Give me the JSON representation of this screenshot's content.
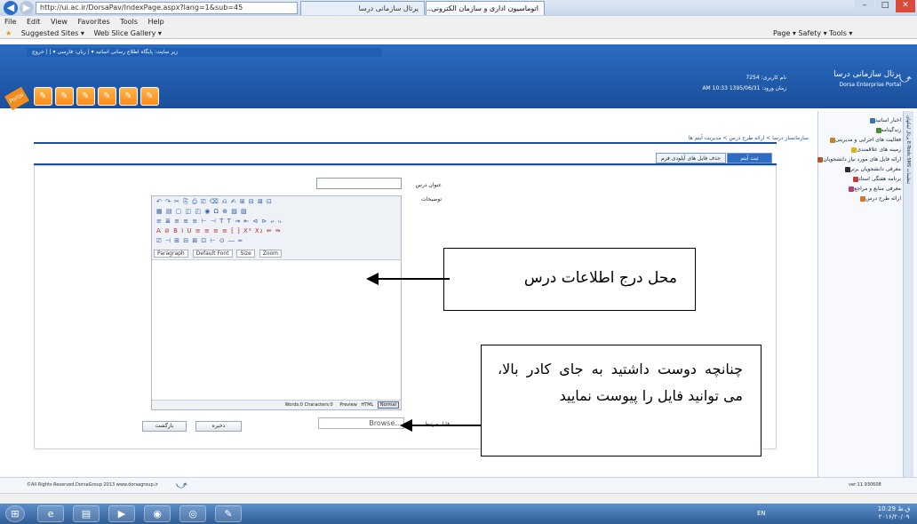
{
  "browser": {
    "address": "http://ui.ac.ir/DorsaPav/IndexPage.aspx?lang=1&sub=45",
    "search_icon": "search-icon",
    "tab1_title": "پرتال سازمانی درسا",
    "tab2_title": "اتوماسیون اداری و سازمان الکترونی...",
    "window_controls": [
      "–",
      "□",
      "✕"
    ]
  },
  "menubar": [
    "File",
    "Edit",
    "View",
    "Favorites",
    "Tools",
    "Help"
  ],
  "favorites": {
    "suggested": "Suggested Sites ▾",
    "slice": "Web Slice Gallery ▾",
    "right_tools": "Page ▾   Safety ▾   Tools ▾"
  },
  "portal": {
    "top_links": "زیر سایت: پایگاه اطلاع رسانی اساتید ▾ | زبان: فارسی ▾ | | خروج",
    "logo_title": "پرتال سازمانی درسا",
    "logo_subtitle": "Dorsa Enterprise Portal",
    "user_line1": "نام کاربری: 7254",
    "user_line2": "زمان ورود: 1395/06/31 10:33 AM",
    "portal_tab": "Portal"
  },
  "sidebar": {
    "items": [
      "اخبار اساتید",
      "زندگینامه",
      "فعالیت های اجرایی و مدیریتی",
      "زمینه های علاقمندی",
      "ارائه فایل های مورد نیاز دانشجویان",
      "معرفی دانشجویان برتر",
      "برنامه هفتگی استاد",
      "معرفی منابع و مراجع",
      "ارائه طرح درس"
    ],
    "stripe_labels": [
      "پرتال",
      "لینکهای",
      "E-Tools",
      "SMS",
      "تنظیمات"
    ]
  },
  "content": {
    "breadcrumb": "سازمانساز درسا > ارائه طرح درس > مدیریت آیتم ها",
    "tab_save": "ثبت آیتم",
    "tab_delete": "حذف فایل های آپلودی فرم",
    "title_label": "عنوان درس",
    "desc_label": "توضیحات",
    "file_label": "فایل مرتبط",
    "browse": "Browse...",
    "save_button": "ذخیره",
    "back_button": "بازگشت"
  },
  "editor": {
    "toolbar_row1": "↶ ↷ ✂ ⎘ ⎙ ⎚ ⌫ ⎌ ✍ ⊞ ⊟ ⊠ ⊡",
    "toolbar_row2": "▦ ▤ ▢ ◫ ◰ ◉ Ω ⊕ ▧ ▨",
    "toolbar_row3": "≡ ≣ ≡ ≡ ≡ ⊢ ⊣ T T ⇥ ⇤ ⊲ ⊳ ⤶ ⤷",
    "toolbar_row4": "A ⊘ B I U ≡ ≡ ≡ ≡ ⁅ ⁆ X² X₂ ⇚ ⇛",
    "toolbar_row5": "⎚ ⊣ ⊞ ⊟ ⊠ ⊡ ⊢ ⊙ ― ═",
    "paragraph": "Paragraph",
    "font": "Default Font",
    "size": "Size",
    "zoom": "Zoom",
    "status": "Words:0 Characters:0",
    "modes": [
      "Preview",
      "HTML",
      "Normal"
    ]
  },
  "callouts": {
    "info_location": "محل درج اطلاعات درس",
    "file_alt": "چنانچه دوست داشتید به جای کادر بالا، می توانید فایل را پیوست نمایید"
  },
  "footer": {
    "copyright": "©All Rights Reserved,DorsaGroup 2013   www.dorsagroup.ir",
    "version": "ver:11.930608"
  },
  "taskbar": {
    "tray": "EN",
    "time": "10:29 ق.ظ",
    "date": "۲۰۱۶/۲۰/۰۹"
  }
}
